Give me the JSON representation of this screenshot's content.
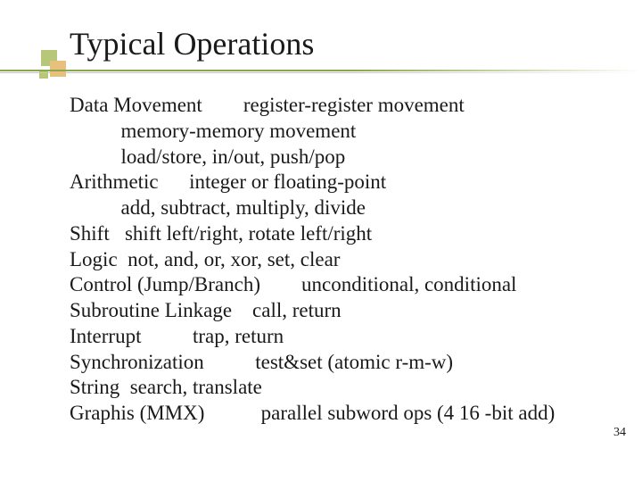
{
  "title": "Typical Operations",
  "lines": {
    "l0": "Data Movement        register-register movement",
    "l1": "          memory-memory movement",
    "l2": "          load/store, in/out, push/pop",
    "l3": "Arithmetic      integer or floating-point",
    "l4": "          add, subtract, multiply, divide",
    "l5": "Shift   shift left/right, rotate left/right",
    "l6": "Logic  not, and, or, xor, set, clear",
    "l7": "Control (Jump/Branch)        unconditional, conditional",
    "l8": "Subroutine Linkage    call, return",
    "l9": "Interrupt          trap, return",
    "l10": "Synchronization          test&set (atomic r-m-w)",
    "l11": "String  search, translate",
    "l12": "Graphis (MMX)           parallel subword ops (4 16 -bit add)"
  },
  "page_number": "34"
}
